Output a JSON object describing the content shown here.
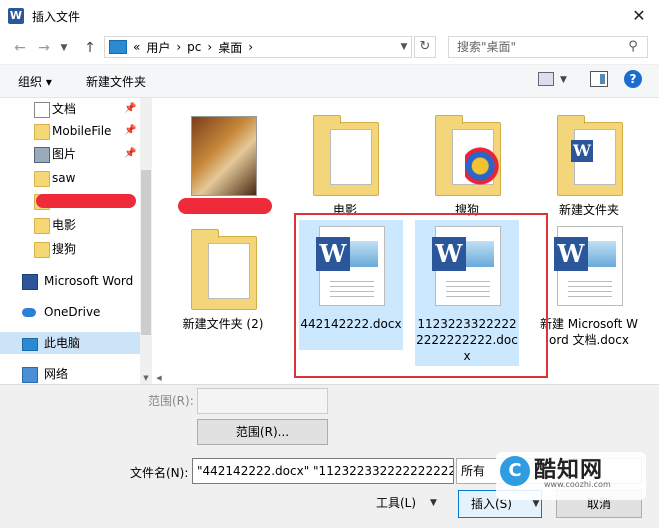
{
  "window": {
    "title": "插入文件",
    "app_letter": "W"
  },
  "address": {
    "breadcrumb_prefix": "«",
    "crumbs": [
      "用户",
      "pc",
      "桌面"
    ],
    "search_placeholder": "搜索\"桌面\""
  },
  "toolbar": {
    "organize": "组织 ▾",
    "new_folder": "新建文件夹"
  },
  "sidebar": {
    "items": [
      {
        "label": "文档",
        "icon": "document-icon"
      },
      {
        "label": "MobileFile",
        "icon": "folder-icon"
      },
      {
        "label": "图片",
        "icon": "picture-icon"
      },
      {
        "label": "saw",
        "icon": "folder-icon"
      },
      {
        "label": "",
        "icon": "folder-icon"
      },
      {
        "label": "电影",
        "icon": "folder-icon"
      },
      {
        "label": "搜狗",
        "icon": "folder-icon"
      },
      {
        "label": "Microsoft Word",
        "icon": "word-icon"
      },
      {
        "label": "OneDrive",
        "icon": "cloud-icon"
      },
      {
        "label": "此电脑",
        "icon": "computer-icon"
      },
      {
        "label": "网络",
        "icon": "network-icon"
      }
    ]
  },
  "files": [
    {
      "name": "",
      "type": "photo"
    },
    {
      "name": "电影",
      "type": "folder"
    },
    {
      "name": "搜狗",
      "type": "sogou"
    },
    {
      "name": "新建文件夹",
      "type": "worddoc"
    },
    {
      "name": "新建文件夹 (2)",
      "type": "folder"
    },
    {
      "name": "442142222.docx",
      "type": "worddoc",
      "selected": true
    },
    {
      "name": "11232233222222222222222.docx",
      "type": "worddoc",
      "selected": true
    },
    {
      "name": "新建 Microsoft Word 文档.docx",
      "type": "worddoc"
    }
  ],
  "bottom": {
    "range_label": "范围(R):",
    "range_button": "范围(R)...",
    "filename_label": "文件名(N):",
    "filename_value": "\"442142222.docx\" \"1123223322222222222",
    "filter_value": "所有",
    "tools_label": "工具(L)",
    "insert_label": "插入(S)",
    "cancel_label": "取消"
  },
  "watermark": {
    "logo_letter": "C",
    "text": "酷知网",
    "url": "www.coozhi.com"
  },
  "colors": {
    "selection": "#cce8ff",
    "highlight_box": "#d8343a",
    "accent": "#0078d7",
    "word_blue": "#2b579a"
  }
}
